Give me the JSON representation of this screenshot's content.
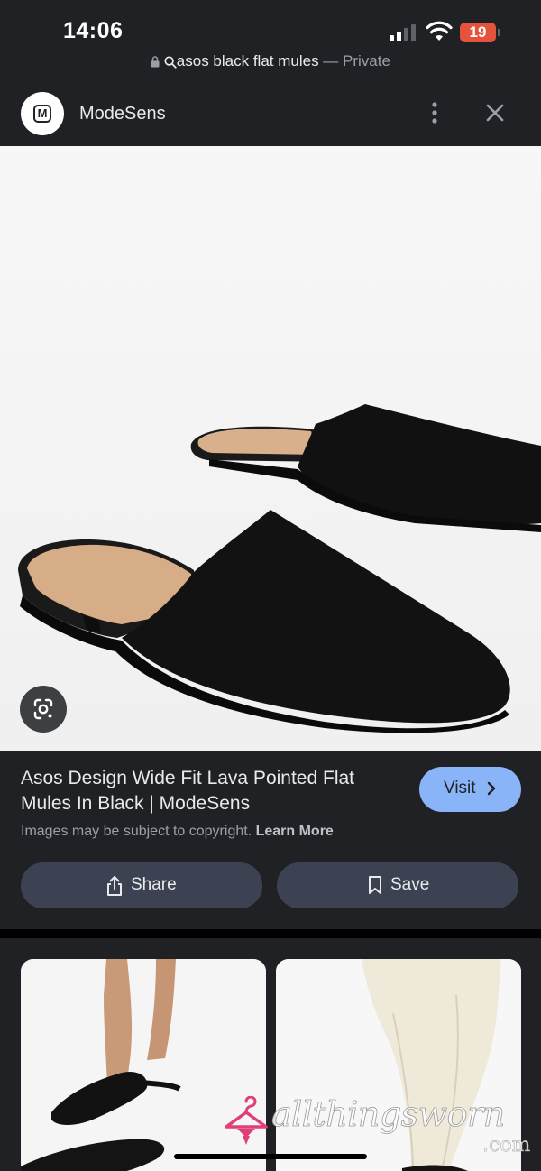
{
  "status_bar": {
    "time": "14:06",
    "battery_level": "19",
    "battery_color": "#e5533d",
    "signal_icon": "cellular-signal-icon",
    "wifi_icon": "wifi-icon"
  },
  "url_bar": {
    "query": "asos black flat mules",
    "separator": " — ",
    "mode": "Private"
  },
  "site_header": {
    "logo_letter": "M",
    "site_name": "ModeSens"
  },
  "hero": {
    "image_subject": "black suede pointed flat mules",
    "lens_icon": "google-lens-icon"
  },
  "product": {
    "title": "Asos Design Wide Fit Lava Pointed Flat Mules In Black | ModeSens",
    "visit_label": "Visit",
    "copyright_notice": "Images may be subject to copyright.",
    "learn_more_label": "Learn More",
    "share_label": "Share",
    "save_label": "Save"
  },
  "related": {
    "cards": [
      {
        "subject": "feet wearing black flat mules"
      },
      {
        "subject": "white trousers with black mules"
      }
    ]
  },
  "watermark": {
    "text": "allthingsworn",
    "suffix": ".com"
  },
  "colors": {
    "background": "#202124",
    "accent": "#8ab4f8",
    "button_bg": "#3c4251"
  }
}
